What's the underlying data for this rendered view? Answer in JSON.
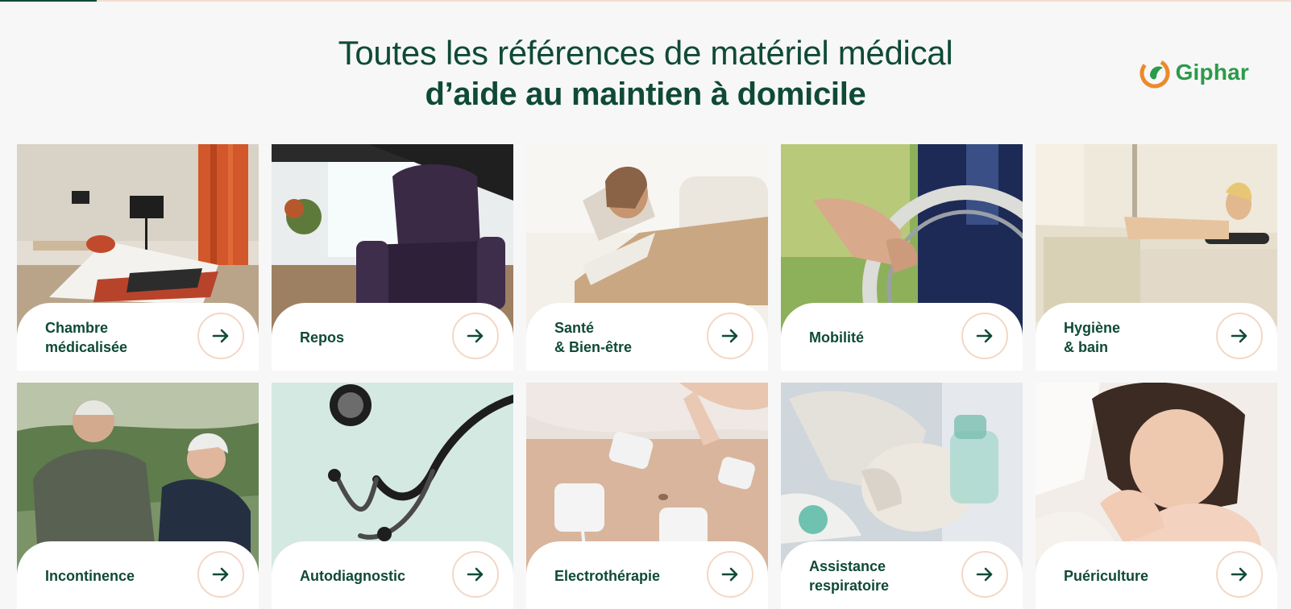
{
  "header": {
    "line1": "Toutes les références de matériel médical",
    "line2": "d’aide au maintien à domicile"
  },
  "brand": {
    "name": "Giphar",
    "icon": "giphar-logo-icon",
    "colors": {
      "green": "#2c9a4a",
      "orange": "#ec8a2b"
    }
  },
  "theme": {
    "primary": "#0f4a37",
    "arrow_border": "#f3d7c6"
  },
  "categories": [
    {
      "label": "Chambre\nmédicalisée",
      "icon": "arrow-right-icon"
    },
    {
      "label": "Repos",
      "icon": "arrow-right-icon"
    },
    {
      "label": "Santé\n& Bien-être",
      "icon": "arrow-right-icon"
    },
    {
      "label": "Mobilité",
      "icon": "arrow-right-icon"
    },
    {
      "label": "Hygiène\n& bain",
      "icon": "arrow-right-icon"
    },
    {
      "label": "Incontinence",
      "icon": "arrow-right-icon"
    },
    {
      "label": "Autodiagnostic",
      "icon": "arrow-right-icon"
    },
    {
      "label": "Electrothérapie",
      "icon": "arrow-right-icon"
    },
    {
      "label": "Assistance\nrespiratoire",
      "icon": "arrow-right-icon"
    },
    {
      "label": "Puériculture",
      "icon": "arrow-right-icon"
    }
  ]
}
